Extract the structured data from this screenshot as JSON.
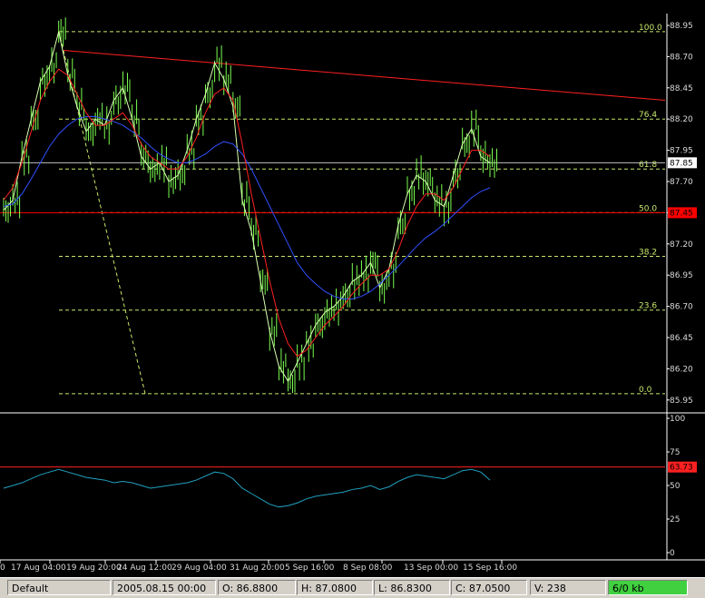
{
  "chart_data": [
    {
      "type": "candlestick",
      "title": "",
      "ylim": [
        85.9,
        89.0
      ],
      "y_ticks": [
        "88.95",
        "88.70",
        "88.45",
        "88.20",
        "87.95",
        "87.70",
        "87.45",
        "87.20",
        "86.95",
        "86.70",
        "86.45",
        "86.20",
        "85.95"
      ],
      "x_ticks": [
        "0",
        "17 Aug 04:00",
        "19 Aug 20:00",
        "24 Aug 12:00",
        "29 Aug 04:00",
        "31 Aug 20:00",
        "5 Sep 16:00",
        "8 Sep 08:00",
        "13 Sep 00:00",
        "15 Sep 16:00"
      ],
      "price_series": [
        87.47,
        87.55,
        87.9,
        88.2,
        88.5,
        88.62,
        88.9,
        88.55,
        88.3,
        88.1,
        88.2,
        88.15,
        88.35,
        88.45,
        88.2,
        87.9,
        87.8,
        87.85,
        87.7,
        87.75,
        87.95,
        88.2,
        88.4,
        88.65,
        88.52,
        88.3,
        87.55,
        87.3,
        86.9,
        86.5,
        86.22,
        86.1,
        86.25,
        86.4,
        86.55,
        86.65,
        86.7,
        86.78,
        86.9,
        86.95,
        87.05,
        86.85,
        87.0,
        87.35,
        87.6,
        87.75,
        87.7,
        87.55,
        87.5,
        87.75,
        88.0,
        88.12,
        87.9,
        87.85
      ],
      "fast_ma": [
        87.55,
        87.65,
        87.85,
        88.1,
        88.35,
        88.5,
        88.6,
        88.55,
        88.4,
        88.25,
        88.15,
        88.15,
        88.2,
        88.25,
        88.15,
        88.0,
        87.9,
        87.85,
        87.8,
        87.8,
        87.9,
        88.05,
        88.25,
        88.4,
        88.45,
        88.35,
        88.0,
        87.6,
        87.25,
        86.9,
        86.6,
        86.4,
        86.3,
        86.35,
        86.45,
        86.55,
        86.62,
        86.7,
        86.8,
        86.88,
        86.95,
        86.95,
        87.0,
        87.15,
        87.35,
        87.5,
        87.6,
        87.6,
        87.55,
        87.65,
        87.8,
        87.95,
        87.95,
        87.9
      ],
      "slow_ma": [
        87.5,
        87.52,
        87.6,
        87.72,
        87.85,
        87.98,
        88.08,
        88.15,
        88.2,
        88.22,
        88.22,
        88.2,
        88.18,
        88.15,
        88.1,
        88.05,
        87.98,
        87.92,
        87.88,
        87.85,
        87.85,
        87.88,
        87.92,
        87.98,
        88.02,
        88.0,
        87.92,
        87.8,
        87.65,
        87.5,
        87.35,
        87.2,
        87.05,
        86.95,
        86.88,
        86.82,
        86.78,
        86.76,
        86.76,
        86.78,
        86.82,
        86.88,
        86.95,
        87.02,
        87.1,
        87.18,
        87.25,
        87.3,
        87.36,
        87.43,
        87.5,
        87.57,
        87.62,
        87.65
      ],
      "series_colors": {
        "price": "#7cff50",
        "fast_ma": "#ff2020",
        "slow_ma": "#3050ff"
      },
      "fibonacci": [
        {
          "label": "100.0",
          "value": 88.9
        },
        {
          "label": "76.4",
          "value": 88.2
        },
        {
          "label": "61.8",
          "value": 87.8
        },
        {
          "label": "50.0",
          "value": 87.45
        },
        {
          "label": "38.2",
          "value": 87.1
        },
        {
          "label": "23.6",
          "value": 86.67
        },
        {
          "label": "0.0",
          "value": 86.0
        }
      ],
      "fib_color": "#c8e86a",
      "trendline": {
        "from": [
          0,
          88.75
        ],
        "to": [
          54,
          88.35
        ],
        "color": "#ff2020"
      },
      "current_price": {
        "label": "87.85",
        "value": 87.85
      },
      "red_level": {
        "label": "87.45",
        "value": 87.45,
        "color": "#ff0000"
      }
    },
    {
      "type": "line",
      "title": "",
      "ylim": [
        0,
        100
      ],
      "y_ticks": [
        "100",
        "75",
        "50",
        "25",
        "0"
      ],
      "values": [
        48,
        50,
        52,
        55,
        58,
        60,
        62,
        60,
        58,
        56,
        55,
        54,
        52,
        53,
        52,
        50,
        48,
        49,
        50,
        51,
        52,
        54,
        57,
        60,
        59,
        55,
        48,
        44,
        40,
        36,
        34,
        35,
        37,
        40,
        42,
        43,
        44,
        45,
        47,
        48,
        50,
        47,
        49,
        53,
        56,
        58,
        57,
        56,
        55,
        58,
        61,
        62,
        60,
        54
      ],
      "level": {
        "label": "63.73",
        "value": 63.73,
        "color": "#ff2020"
      },
      "line_color": "#20a0c0"
    }
  ],
  "statusbar": {
    "profile": "Default",
    "datetime": "2005.08.15 00:00",
    "open": "O: 86.8800",
    "high": "H: 87.0800",
    "low": "L: 86.8300",
    "close": "C: 87.0500",
    "volume": "V: 238",
    "traffic": "6/0 kb"
  }
}
